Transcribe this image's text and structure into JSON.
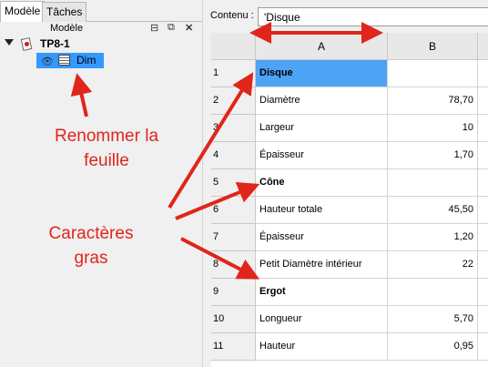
{
  "left_panel": {
    "tabs": [
      {
        "label": "Modèle",
        "active": true
      },
      {
        "label": "Tâches",
        "active": false
      }
    ],
    "header_title": "Modèle",
    "header_icons": [
      "restore-icon",
      "float-icon",
      "close-icon"
    ],
    "tree": {
      "root_label": "TP8-1",
      "selected_item_label": "Dim"
    }
  },
  "annotations": {
    "rename_line1": "Renommer la",
    "rename_line2": "feuille",
    "bold_line1": "Caractères",
    "bold_line2": "gras",
    "arrow_color": "#e0251b"
  },
  "formula_bar": {
    "label": "Contenu :",
    "value": "'Disque"
  },
  "sheet": {
    "columns": [
      "A",
      "B"
    ],
    "rows": [
      {
        "n": "1",
        "a": "Disque",
        "b": "",
        "bold": true,
        "selected": true
      },
      {
        "n": "2",
        "a": "Diamètre",
        "b": "78,70",
        "bold": false,
        "selected": false
      },
      {
        "n": "3",
        "a": "Largeur",
        "b": "10",
        "bold": false,
        "selected": false
      },
      {
        "n": "4",
        "a": "Épaisseur",
        "b": "1,70",
        "bold": false,
        "selected": false
      },
      {
        "n": "5",
        "a": "Cône",
        "b": "",
        "bold": true,
        "selected": false
      },
      {
        "n": "6",
        "a": "Hauteur totale",
        "b": "45,50",
        "bold": false,
        "selected": false
      },
      {
        "n": "7",
        "a": "Épaisseur",
        "b": "1,20",
        "bold": false,
        "selected": false
      },
      {
        "n": "8",
        "a": "Petit Diamètre intérieur",
        "b": "22",
        "bold": false,
        "selected": false
      },
      {
        "n": "9",
        "a": "Ergot",
        "b": "",
        "bold": true,
        "selected": false
      },
      {
        "n": "10",
        "a": "Longueur",
        "b": "5,70",
        "bold": false,
        "selected": false
      },
      {
        "n": "11",
        "a": "Hauteur",
        "b": "0,95",
        "bold": false,
        "selected": false
      }
    ]
  }
}
